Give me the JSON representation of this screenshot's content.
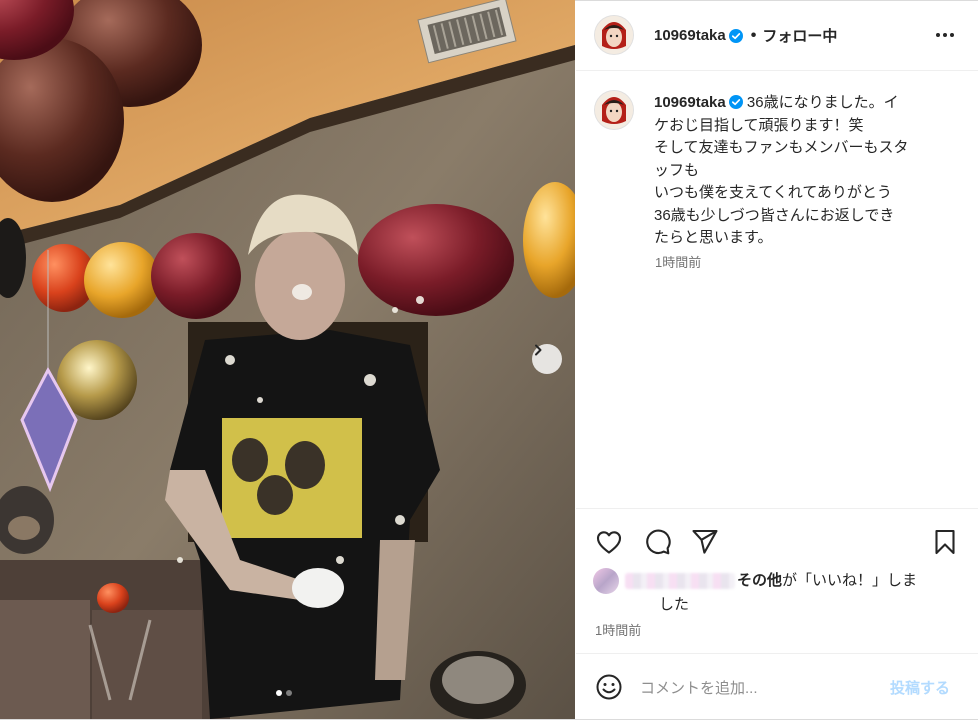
{
  "post": {
    "username": "10969taka",
    "verified": true,
    "separator": "•",
    "follow_state": "フォロー中",
    "more_icon": "more-horizontal-icon",
    "caption_lines": [
      "36歳になりました。イ",
      "ケおじ目指して頑張ります！笑",
      "そして友達もファンもメンバーもスタ",
      "ッフも",
      "いつも僕を支えてくれてありがとう",
      "36歳も少しづつ皆さんにお返しでき",
      "たらと思います。"
    ],
    "caption_time": "1時間前",
    "likes": {
      "others_bold": "その他",
      "line1_rest": "が「いいね！」しま",
      "line2": "した"
    },
    "post_time": "1時間前",
    "comment": {
      "placeholder": "コメントを追加...",
      "value": "",
      "submit_label": "投稿する"
    },
    "carousel": {
      "total": 2,
      "current": 1
    },
    "colors": {
      "verified": "#0095f6",
      "submit_disabled": "#b3dbff",
      "meta": "#737373"
    }
  }
}
